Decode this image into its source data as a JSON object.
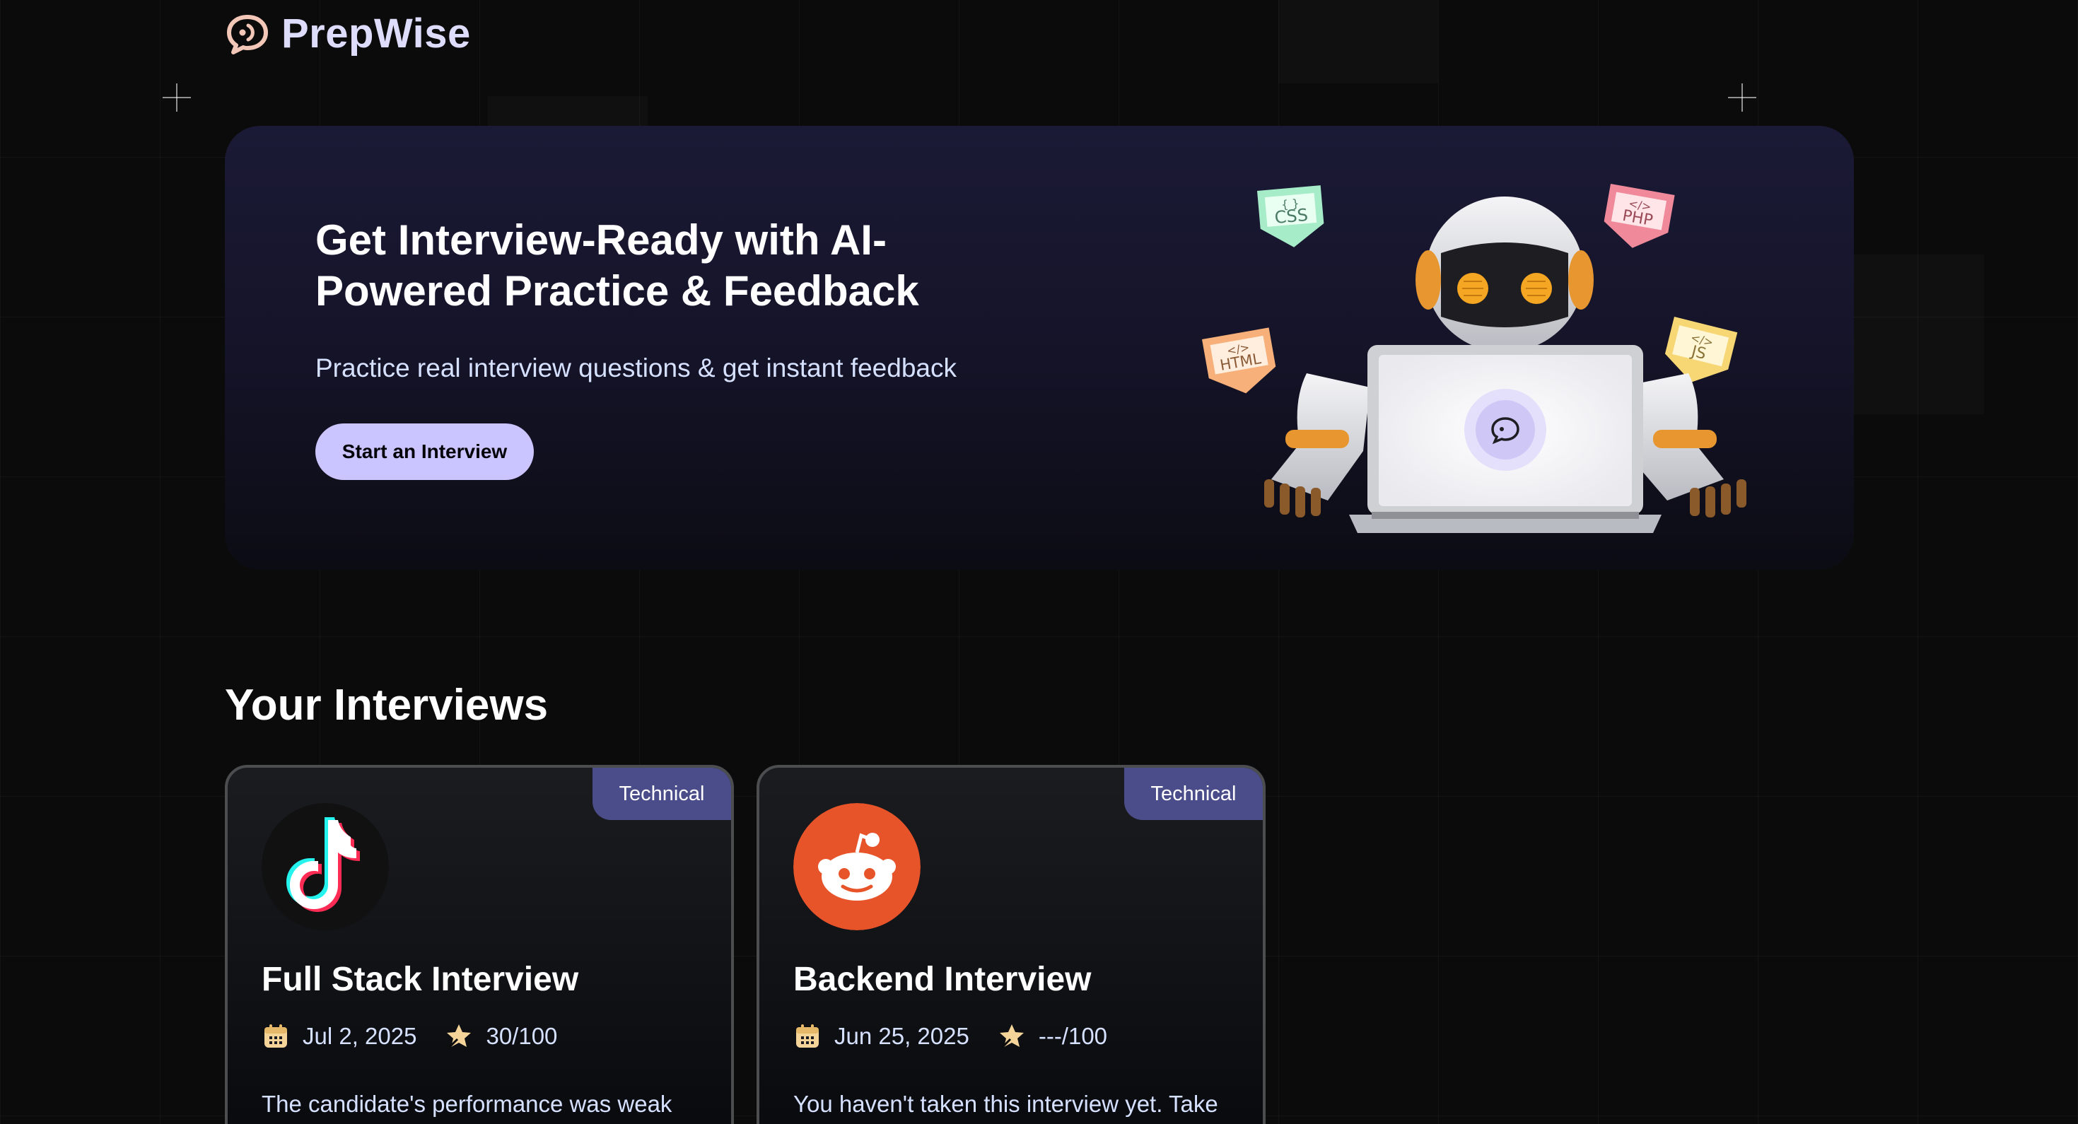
{
  "app": {
    "name": "PrepWise"
  },
  "hero": {
    "title": "Get Interview-Ready with AI-Powered Practice & Feedback",
    "subtitle": "Practice real interview questions & get instant feedback",
    "cta_label": "Start an Interview",
    "tags": [
      "CSS",
      "PHP",
      "HTML",
      "JS"
    ]
  },
  "section": {
    "title": "Your Interviews"
  },
  "interviews": [
    {
      "title": "Full Stack Interview",
      "type": "Technical",
      "date": "Jul 2, 2025",
      "score": "30/100",
      "description": "The candidate's performance was weak",
      "logo": "tiktok-logo"
    },
    {
      "title": "Backend Interview",
      "type": "Technical",
      "date": "Jun 25, 2025",
      "score": "---/100",
      "description": "You haven't taken this interview yet. Take",
      "logo": "reddit-logo"
    }
  ],
  "colors": {
    "background": "#0b0b0c",
    "brand": "#dedcfb",
    "cta": "#cac5fe",
    "badge": "#4b4d8a",
    "reddit": "#e8542a",
    "accent_orange": "#f5a623"
  }
}
